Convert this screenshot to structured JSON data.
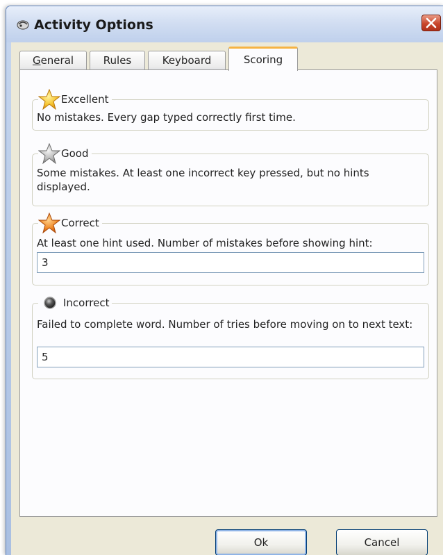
{
  "window": {
    "title": "Activity Options"
  },
  "tabs": [
    {
      "label": "General",
      "underline": "G",
      "rest": "eneral"
    },
    {
      "label": "Rules"
    },
    {
      "label": "Keyboard"
    },
    {
      "label": "Scoring",
      "active": true
    }
  ],
  "scoring": {
    "excellent": {
      "title": "Excellent",
      "icon": "gold-star-icon",
      "description": "No mistakes.  Every gap typed correctly first time."
    },
    "good": {
      "title": "Good",
      "icon": "grey-star-icon",
      "description": "Some mistakes.  At least one incorrect key pressed, but no hints displayed."
    },
    "correct": {
      "title": "Correct",
      "icon": "orange-star-icon",
      "description": "At least one hint used.  Number of mistakes before showing hint:",
      "value": "3"
    },
    "incorrect": {
      "title": "Incorrect",
      "icon": "dark-circle-icon",
      "description": "Failed to complete word. Number of tries before moving on to next text:",
      "value": "5"
    }
  },
  "buttons": {
    "ok": "Ok",
    "cancel": "Cancel"
  },
  "colors": {
    "title_bar": "#c6d6ee",
    "close_button": "#c9462b",
    "active_tab_accent": "#f6b343",
    "dialog_face": "#ece9d8"
  }
}
